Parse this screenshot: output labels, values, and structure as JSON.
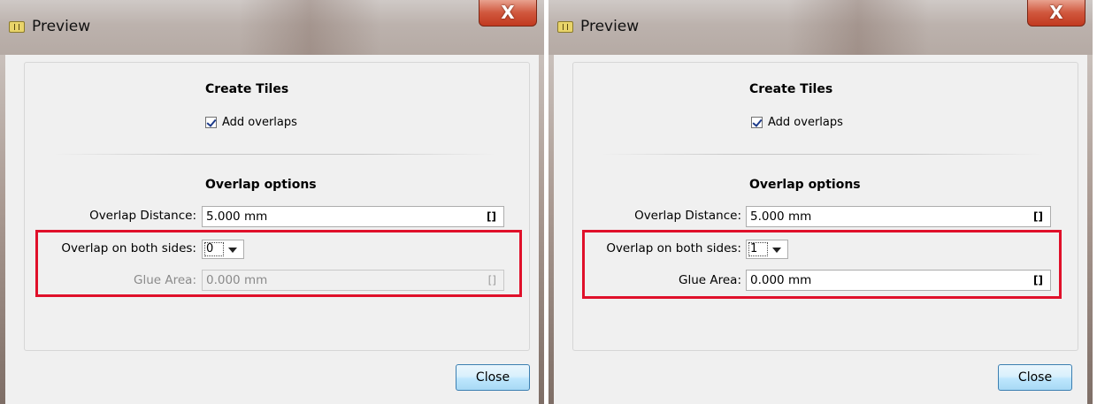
{
  "windows": [
    {
      "title": "Preview",
      "close_glyph": "X",
      "section_create": "Create Tiles",
      "add_overlaps_label": "Add overlaps",
      "add_overlaps_checked": true,
      "section_overlap": "Overlap options",
      "overlap_distance_label": "Overlap Distance:",
      "overlap_distance_value": "5.000 mm",
      "unit_icon": "[]",
      "overlap_both_label": "Overlap on both sides:",
      "overlap_both_value": "0",
      "glue_area_label": "Glue Area:",
      "glue_area_value": "0.000 mm",
      "glue_area_enabled": false,
      "close_button": "Close"
    },
    {
      "title": "Preview",
      "close_glyph": "X",
      "section_create": "Create Tiles",
      "add_overlaps_label": "Add overlaps",
      "add_overlaps_checked": true,
      "section_overlap": "Overlap options",
      "overlap_distance_label": "Overlap Distance:",
      "overlap_distance_value": "5.000 mm",
      "unit_icon": "[]",
      "overlap_both_label": "Overlap on both sides:",
      "overlap_both_value": "1",
      "glue_area_label": "Glue Area:",
      "glue_area_value": "0.000 mm",
      "glue_area_enabled": true,
      "close_button": "Close"
    }
  ],
  "colors": {
    "highlight": "#e0102a",
    "titlebar": "#bcb2ad",
    "close_x": "#c23a20"
  }
}
